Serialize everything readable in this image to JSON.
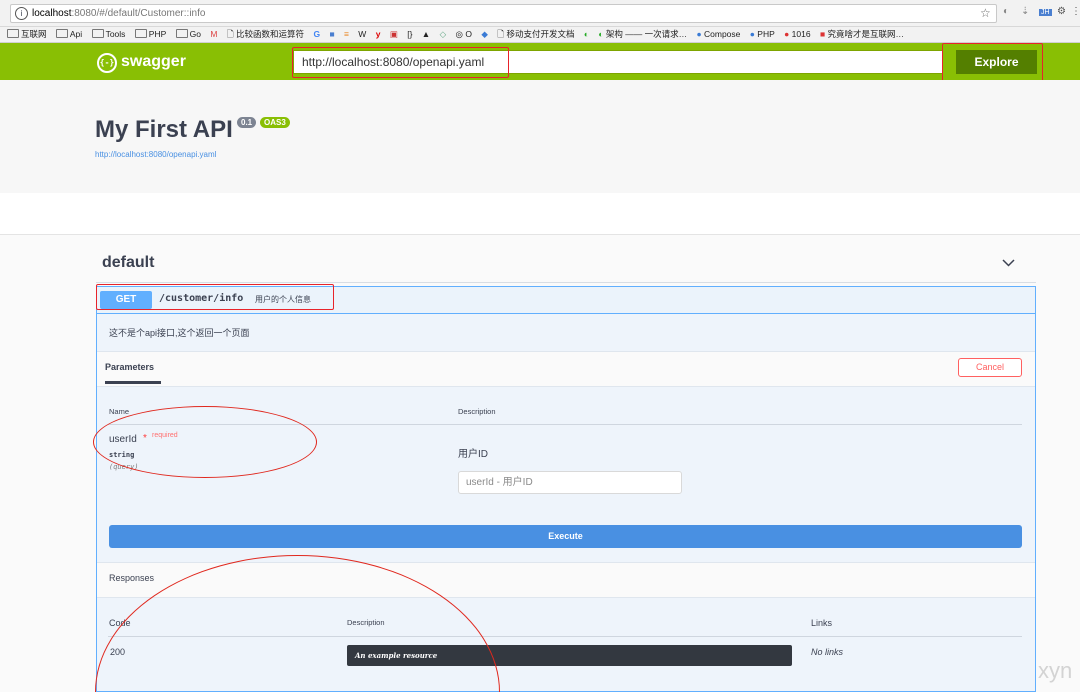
{
  "browser": {
    "url_host": "localhost",
    "url_rest": ":8080/#/default/Customer::info",
    "bookmarks": [
      "互联网",
      "Api",
      "Tools",
      "PHP",
      "Go",
      "比较函数和运算符",
      "O",
      "移动支付开发文档",
      "架构 —— 一次请求…",
      "Compose",
      "PHP",
      "1016",
      "究竟啥才是互联网…"
    ]
  },
  "topbar": {
    "logo_text": "swagger",
    "url_value": "http://localhost:8080/openapi.yaml",
    "explore_label": "Explore"
  },
  "info": {
    "title": "My First API",
    "version": "0.1",
    "oas": "OAS3",
    "spec_url": "http://localhost:8080/openapi.yaml"
  },
  "tag": {
    "name": "default"
  },
  "operation": {
    "method": "GET",
    "path": "/customer/info",
    "summary": "用户的个人信息",
    "description": "这不是个api接口,这个返回一个页面",
    "parameters_tab": "Parameters",
    "cancel_label": "Cancel",
    "columns": {
      "name": "Name",
      "description": "Description"
    },
    "param": {
      "name": "userId",
      "required_mark": "*",
      "required_text": "required",
      "type": "string",
      "in": "(query)",
      "description": "用户ID",
      "placeholder": "userId - 用户ID"
    },
    "execute_label": "Execute",
    "responses_title": "Responses",
    "response_columns": {
      "code": "Code",
      "description": "Description",
      "links": "Links"
    },
    "response": {
      "code": "200",
      "description": "An example resource",
      "links": "No links"
    }
  },
  "watermark": "xyn"
}
